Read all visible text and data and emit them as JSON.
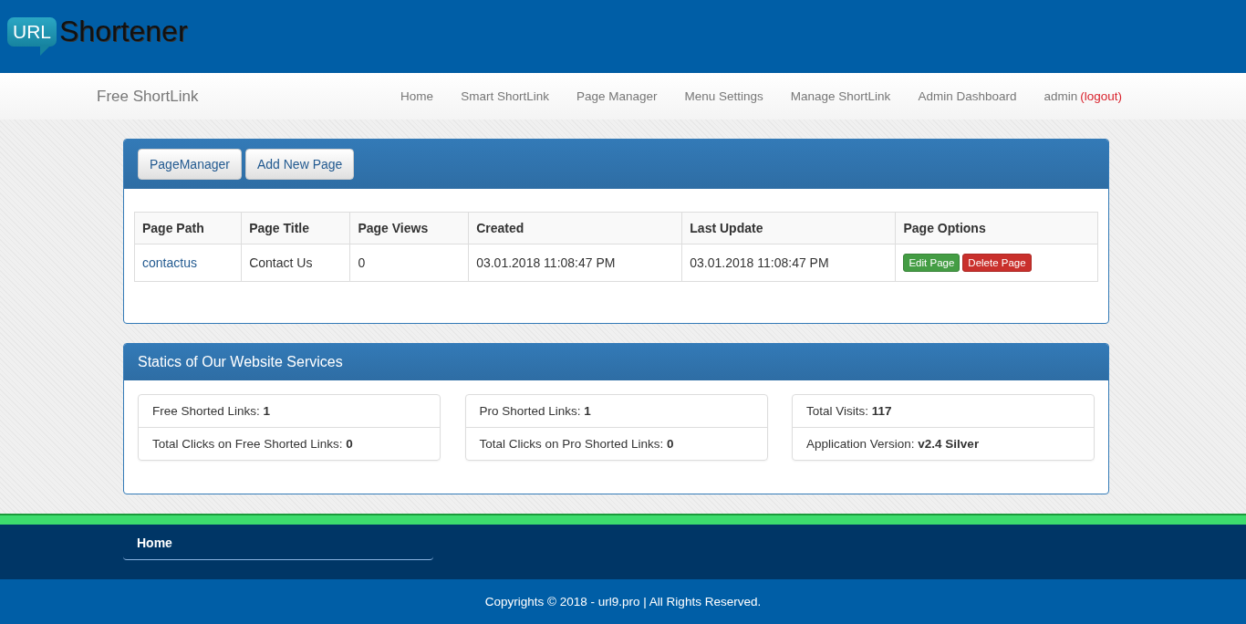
{
  "logo": {
    "badge": "URL",
    "text": "Shortener"
  },
  "navbar": {
    "brand": "Free ShortLink",
    "items": [
      {
        "label": "Home"
      },
      {
        "label": "Smart ShortLink"
      },
      {
        "label": "Page Manager"
      },
      {
        "label": "Menu Settings"
      },
      {
        "label": "Manage ShortLink"
      },
      {
        "label": "Admin Dashboard"
      }
    ],
    "user": "admin",
    "logout": "(logout)"
  },
  "page_panel": {
    "buttons": [
      "PageManager",
      "Add New Page"
    ],
    "table": {
      "columns": [
        "Page Path",
        "Page Title",
        "Page Views",
        "Created",
        "Last Update",
        "Page Options"
      ],
      "rows": [
        {
          "path": "contactus",
          "title": "Contact Us",
          "views": "0",
          "created": "03.01.2018 11:08:47 PM",
          "updated": "03.01.2018 11:08:47 PM",
          "actions": [
            {
              "label": "Edit Page",
              "kind": "edit"
            },
            {
              "label": "Delete Page",
              "kind": "delete"
            }
          ]
        }
      ]
    }
  },
  "stats_panel": {
    "title": "Statics of Our Website Services",
    "groups": [
      [
        "Free Shorted Links: **1**",
        "Total Clicks on Free Shorted Links: **0**"
      ],
      [
        "Pro Shorted Links: **1**",
        "Total Clicks on Pro Shorted Links: **0**"
      ],
      [
        "Total Visits: **117**",
        "Application Version: **v2.4 Silver**"
      ]
    ]
  },
  "footer": {
    "menu": [
      "Home"
    ],
    "copyright": "Copyrights © 2018 - url9.pro | All Rights Reserved."
  }
}
